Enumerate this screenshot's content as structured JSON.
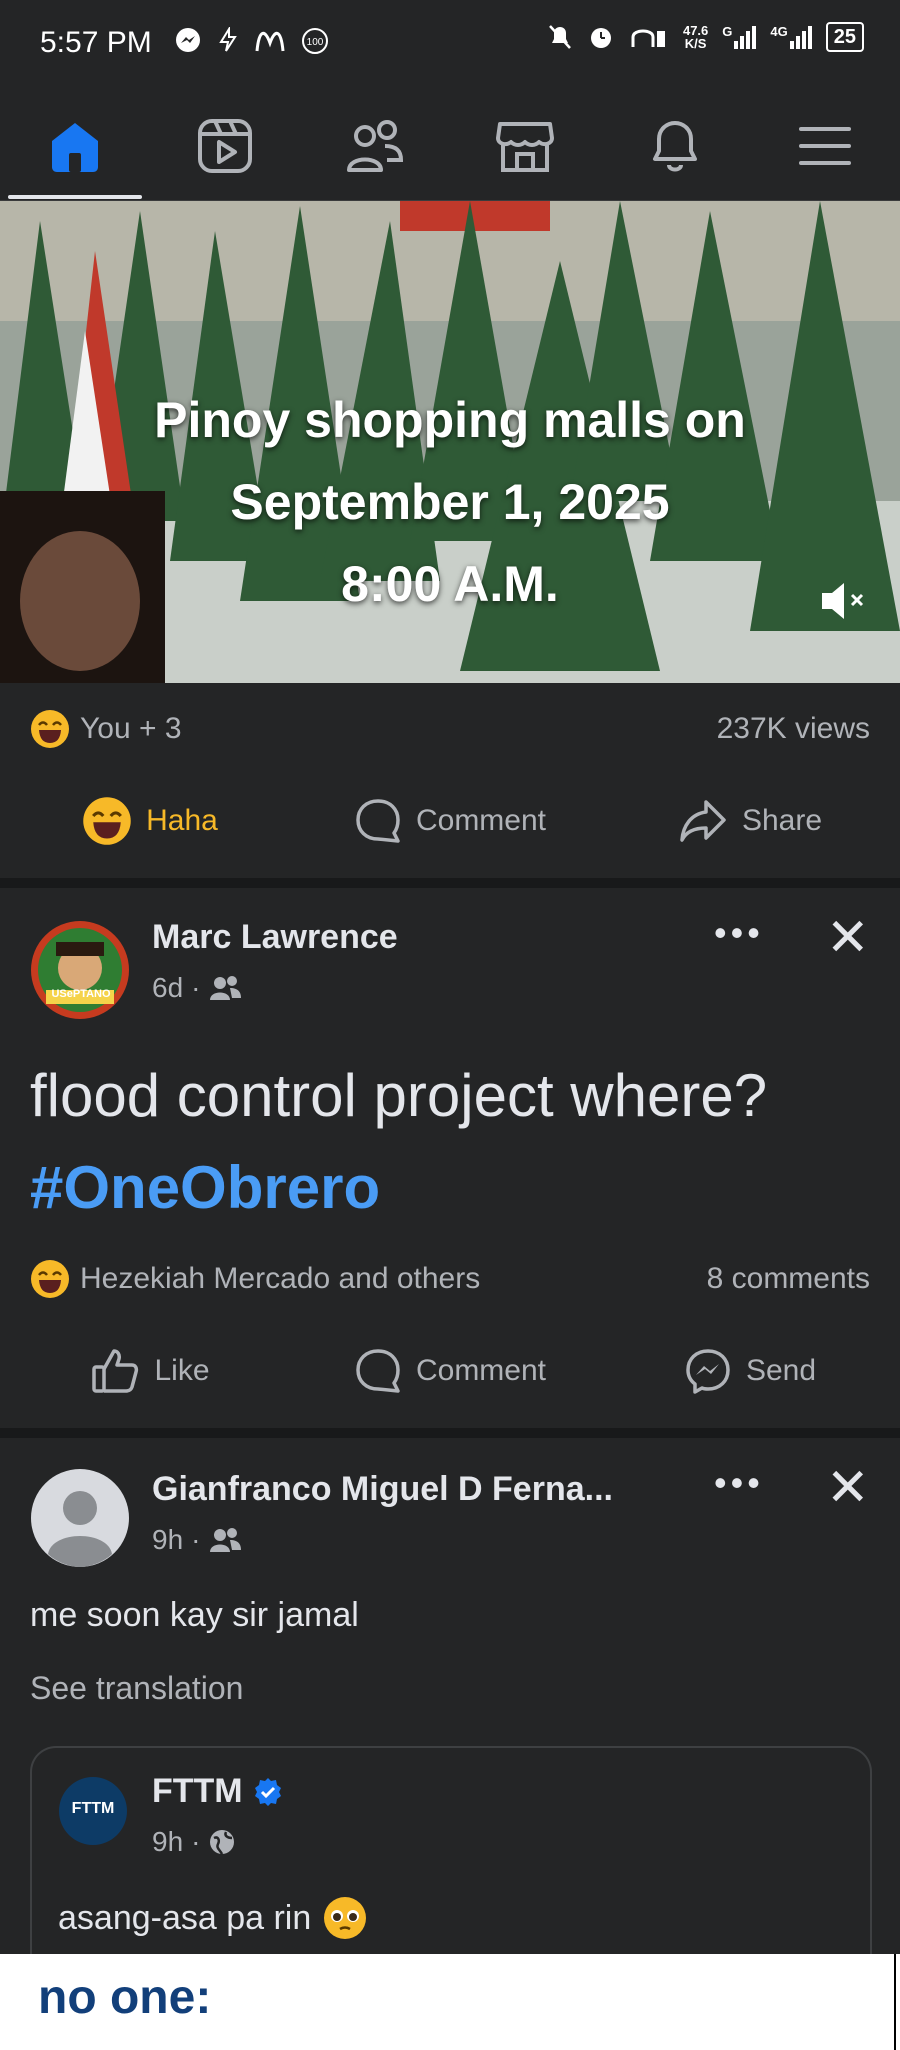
{
  "status_bar": {
    "time": "5:57 PM",
    "net_speed": "47.6",
    "net_unit": "K/S",
    "signal_g": "G",
    "signal_4g": "4G",
    "battery": "25"
  },
  "nav": {
    "tabs": [
      "home-icon",
      "video-icon",
      "friends-icon",
      "marketplace-icon",
      "notifications-icon",
      "menu-icon"
    ],
    "active_color": "#1877f2"
  },
  "video_post": {
    "overlay_line1": "Pinoy shopping malls on",
    "overlay_line2": "September 1, 2025",
    "overlay_line3": "8:00 A.M.",
    "reactions_text": "You + 3",
    "views": "237K views",
    "actions": {
      "haha": "Haha",
      "comment": "Comment",
      "share": "Share"
    }
  },
  "post2": {
    "author": "Marc Lawrence",
    "time": "6d",
    "avatar_caption": "USePTANO",
    "text_main": "flood control project where? ",
    "hashtag": "#OneObrero",
    "reactions_text": "Hezekiah Mercado and others",
    "comments": "8 comments",
    "actions": {
      "like": "Like",
      "comment": "Comment",
      "send": "Send"
    }
  },
  "post3": {
    "author": "Gianfranco Miguel D Ferna...",
    "time": "9h",
    "text": "me soon kay sir jamal",
    "see_translation": "See translation",
    "shared": {
      "author": "FTTM",
      "avatar_label": "FTTM",
      "time": "9h",
      "text": "asang-asa pa rin"
    }
  },
  "bottom_image": {
    "text": "no one:"
  },
  "colors": {
    "accent": "#1877f2",
    "hashtag": "#4a9cf5",
    "haha": "#f7b928"
  }
}
